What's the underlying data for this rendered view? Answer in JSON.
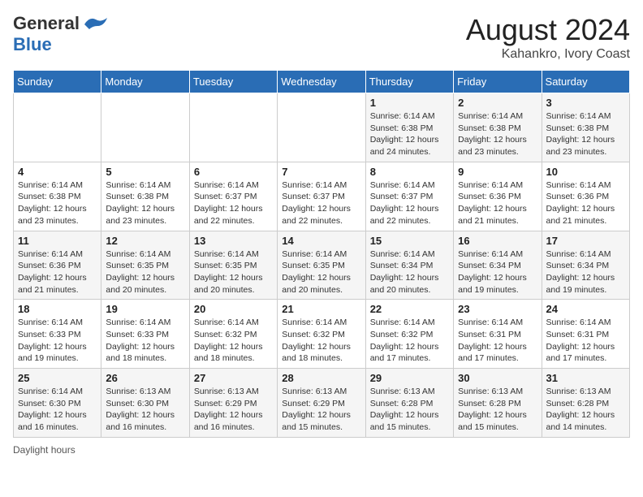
{
  "header": {
    "logo_line1": "General",
    "logo_line2": "Blue",
    "title": "August 2024",
    "subtitle": "Kahankro, Ivory Coast"
  },
  "days_of_week": [
    "Sunday",
    "Monday",
    "Tuesday",
    "Wednesday",
    "Thursday",
    "Friday",
    "Saturday"
  ],
  "weeks": [
    [
      {
        "day": "",
        "info": ""
      },
      {
        "day": "",
        "info": ""
      },
      {
        "day": "",
        "info": ""
      },
      {
        "day": "",
        "info": ""
      },
      {
        "day": "1",
        "info": "Sunrise: 6:14 AM\nSunset: 6:38 PM\nDaylight: 12 hours and 24 minutes."
      },
      {
        "day": "2",
        "info": "Sunrise: 6:14 AM\nSunset: 6:38 PM\nDaylight: 12 hours and 23 minutes."
      },
      {
        "day": "3",
        "info": "Sunrise: 6:14 AM\nSunset: 6:38 PM\nDaylight: 12 hours and 23 minutes."
      }
    ],
    [
      {
        "day": "4",
        "info": "Sunrise: 6:14 AM\nSunset: 6:38 PM\nDaylight: 12 hours and 23 minutes."
      },
      {
        "day": "5",
        "info": "Sunrise: 6:14 AM\nSunset: 6:38 PM\nDaylight: 12 hours and 23 minutes."
      },
      {
        "day": "6",
        "info": "Sunrise: 6:14 AM\nSunset: 6:37 PM\nDaylight: 12 hours and 22 minutes."
      },
      {
        "day": "7",
        "info": "Sunrise: 6:14 AM\nSunset: 6:37 PM\nDaylight: 12 hours and 22 minutes."
      },
      {
        "day": "8",
        "info": "Sunrise: 6:14 AM\nSunset: 6:37 PM\nDaylight: 12 hours and 22 minutes."
      },
      {
        "day": "9",
        "info": "Sunrise: 6:14 AM\nSunset: 6:36 PM\nDaylight: 12 hours and 21 minutes."
      },
      {
        "day": "10",
        "info": "Sunrise: 6:14 AM\nSunset: 6:36 PM\nDaylight: 12 hours and 21 minutes."
      }
    ],
    [
      {
        "day": "11",
        "info": "Sunrise: 6:14 AM\nSunset: 6:36 PM\nDaylight: 12 hours and 21 minutes."
      },
      {
        "day": "12",
        "info": "Sunrise: 6:14 AM\nSunset: 6:35 PM\nDaylight: 12 hours and 20 minutes."
      },
      {
        "day": "13",
        "info": "Sunrise: 6:14 AM\nSunset: 6:35 PM\nDaylight: 12 hours and 20 minutes."
      },
      {
        "day": "14",
        "info": "Sunrise: 6:14 AM\nSunset: 6:35 PM\nDaylight: 12 hours and 20 minutes."
      },
      {
        "day": "15",
        "info": "Sunrise: 6:14 AM\nSunset: 6:34 PM\nDaylight: 12 hours and 20 minutes."
      },
      {
        "day": "16",
        "info": "Sunrise: 6:14 AM\nSunset: 6:34 PM\nDaylight: 12 hours and 19 minutes."
      },
      {
        "day": "17",
        "info": "Sunrise: 6:14 AM\nSunset: 6:34 PM\nDaylight: 12 hours and 19 minutes."
      }
    ],
    [
      {
        "day": "18",
        "info": "Sunrise: 6:14 AM\nSunset: 6:33 PM\nDaylight: 12 hours and 19 minutes."
      },
      {
        "day": "19",
        "info": "Sunrise: 6:14 AM\nSunset: 6:33 PM\nDaylight: 12 hours and 18 minutes."
      },
      {
        "day": "20",
        "info": "Sunrise: 6:14 AM\nSunset: 6:32 PM\nDaylight: 12 hours and 18 minutes."
      },
      {
        "day": "21",
        "info": "Sunrise: 6:14 AM\nSunset: 6:32 PM\nDaylight: 12 hours and 18 minutes."
      },
      {
        "day": "22",
        "info": "Sunrise: 6:14 AM\nSunset: 6:32 PM\nDaylight: 12 hours and 17 minutes."
      },
      {
        "day": "23",
        "info": "Sunrise: 6:14 AM\nSunset: 6:31 PM\nDaylight: 12 hours and 17 minutes."
      },
      {
        "day": "24",
        "info": "Sunrise: 6:14 AM\nSunset: 6:31 PM\nDaylight: 12 hours and 17 minutes."
      }
    ],
    [
      {
        "day": "25",
        "info": "Sunrise: 6:14 AM\nSunset: 6:30 PM\nDaylight: 12 hours and 16 minutes."
      },
      {
        "day": "26",
        "info": "Sunrise: 6:13 AM\nSunset: 6:30 PM\nDaylight: 12 hours and 16 minutes."
      },
      {
        "day": "27",
        "info": "Sunrise: 6:13 AM\nSunset: 6:29 PM\nDaylight: 12 hours and 16 minutes."
      },
      {
        "day": "28",
        "info": "Sunrise: 6:13 AM\nSunset: 6:29 PM\nDaylight: 12 hours and 15 minutes."
      },
      {
        "day": "29",
        "info": "Sunrise: 6:13 AM\nSunset: 6:28 PM\nDaylight: 12 hours and 15 minutes."
      },
      {
        "day": "30",
        "info": "Sunrise: 6:13 AM\nSunset: 6:28 PM\nDaylight: 12 hours and 15 minutes."
      },
      {
        "day": "31",
        "info": "Sunrise: 6:13 AM\nSunset: 6:28 PM\nDaylight: 12 hours and 14 minutes."
      }
    ]
  ],
  "footer": {
    "daylight_label": "Daylight hours"
  }
}
